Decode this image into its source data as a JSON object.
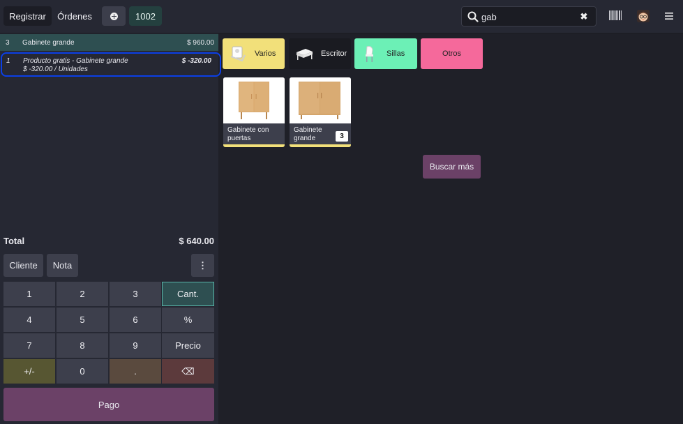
{
  "topbar": {
    "registrar_label": "Registrar",
    "ordenes_label": "Órdenes",
    "order_number": "1002",
    "search_value": "gab",
    "search_clear": "✖"
  },
  "orderlines": [
    {
      "qty": "3",
      "name": "Gabinete grande",
      "price": "$ 960.00"
    },
    {
      "qty": "1",
      "name": "Producto gratis - Gabinete grande",
      "price": "$ -320.00",
      "sub": "$ -320.00 / Unidades"
    }
  ],
  "summary": {
    "total_label": "Total",
    "total_value": "$ 640.00"
  },
  "controls": {
    "cliente": "Cliente",
    "nota": "Nota",
    "more": "⋮"
  },
  "numpad": {
    "k1": "1",
    "k2": "2",
    "k3": "3",
    "cant": "Cant.",
    "k4": "4",
    "k5": "5",
    "k6": "6",
    "pct": "%",
    "k7": "7",
    "k8": "8",
    "k9": "9",
    "precio": "Precio",
    "sign": "+/-",
    "k0": "0",
    "dot": ".",
    "back": "⌫"
  },
  "pago_label": "Pago",
  "categories": [
    {
      "label": "Varios",
      "color": "#f2e07a"
    },
    {
      "label": "Escritor",
      "color": "#1a1b21"
    },
    {
      "label": "Sillas",
      "color": "#6cf0b6"
    },
    {
      "label": "Otros",
      "color": "#f5699b"
    }
  ],
  "products": [
    {
      "name": "Gabinete con puertas"
    },
    {
      "name": "Gabinete grande",
      "badge": "3"
    }
  ],
  "buscar_label": "Buscar más",
  "icons": [
    "search-icon",
    "clear-icon",
    "barcode-icon",
    "avatar",
    "menu-icon",
    "plus-icon",
    "backspace-icon"
  ]
}
